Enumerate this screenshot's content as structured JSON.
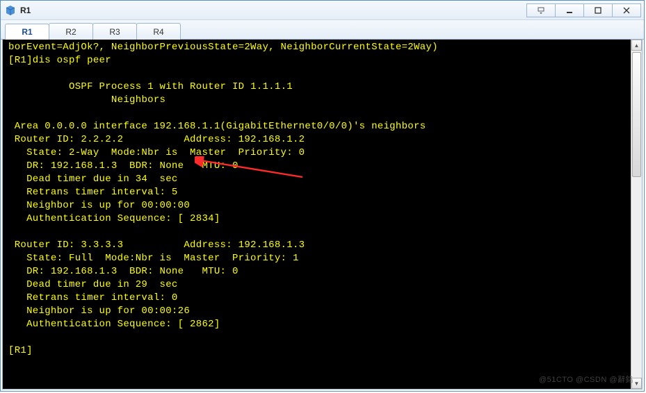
{
  "window": {
    "title": "R1"
  },
  "tabs": [
    {
      "label": "R1",
      "active": true
    },
    {
      "label": "R2",
      "active": false
    },
    {
      "label": "R3",
      "active": false
    },
    {
      "label": "R4",
      "active": false
    }
  ],
  "terminal": {
    "lines": [
      "borEvent=AdjOk?, NeighborPreviousState=2Way, NeighborCurrentState=2Way)",
      "[R1]dis ospf peer",
      "",
      "\t  OSPF Process 1 with Router ID 1.1.1.1",
      "\t\t Neighbors",
      "",
      " Area 0.0.0.0 interface 192.168.1.1(GigabitEthernet0/0/0)'s neighbors",
      " Router ID: 2.2.2.2          Address: 192.168.1.2",
      "   State: 2-Way  Mode:Nbr is  Master  Priority: 0",
      "   DR: 192.168.1.3  BDR: None   MTU: 0",
      "   Dead timer due in 34  sec",
      "   Retrans timer interval: 5",
      "   Neighbor is up for 00:00:00",
      "   Authentication Sequence: [ 2834]",
      "",
      " Router ID: 3.3.3.3          Address: 192.168.1.3",
      "   State: Full  Mode:Nbr is  Master  Priority: 1",
      "   DR: 192.168.1.3  BDR: None   MTU: 0",
      "   Dead timer due in 29  sec",
      "   Retrans timer interval: 0",
      "   Neighbor is up for 00:00:26",
      "   Authentication Sequence: [ 2862]",
      "",
      "[R1]"
    ]
  },
  "watermark": "@51CTO @CSDN @辭銘"
}
